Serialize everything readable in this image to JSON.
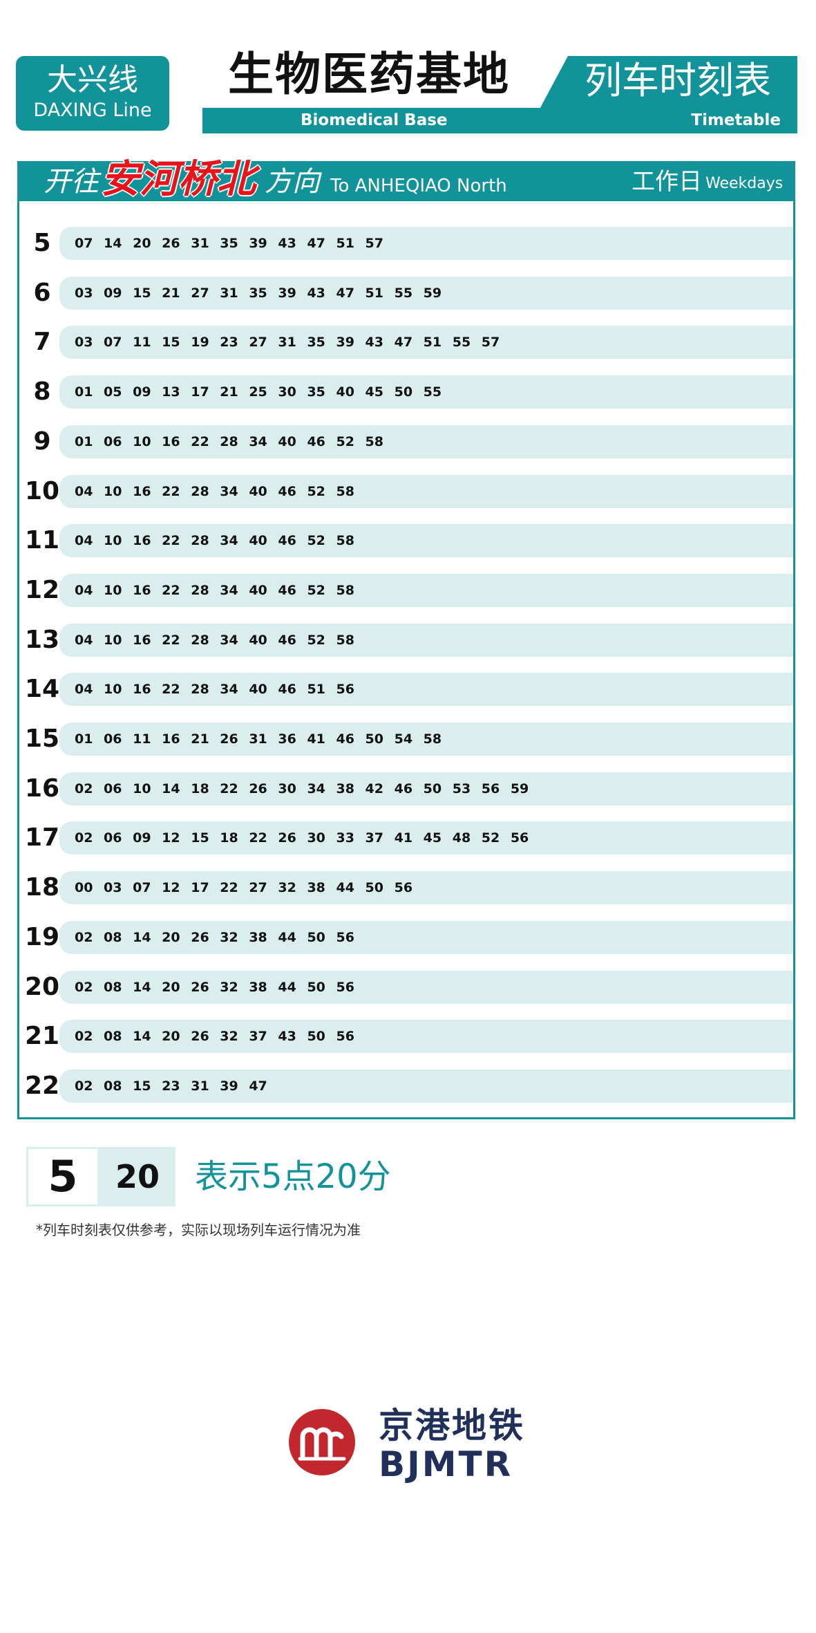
{
  "header": {
    "line_cn": "大兴线",
    "line_en": "DAXING Line",
    "station_cn": "生物医药基地",
    "station_en": "Biomedical Base",
    "timetable_cn": "列车时刻表",
    "timetable_en": "Timetable"
  },
  "panel": {
    "direction_prefix": "开往",
    "direction_name": "安河桥北",
    "direction_suffix": "方向",
    "direction_en": "To ANHEQIAO North",
    "day_cn": "工作日",
    "day_en": "Weekdays"
  },
  "schedule": [
    {
      "hour": "5",
      "minutes": "07 14 20 26 31 35 39 43 47 51 57"
    },
    {
      "hour": "6",
      "minutes": "03 09 15 21 27 31 35 39 43 47 51 55 59"
    },
    {
      "hour": "7",
      "minutes": "03 07 11 15 19 23 27 31 35 39 43 47 51 55 57"
    },
    {
      "hour": "8",
      "minutes": "01 05 09 13 17 21 25 30 35 40 45 50 55"
    },
    {
      "hour": "9",
      "minutes": "01 06 10 16 22 28 34 40 46 52 58"
    },
    {
      "hour": "10",
      "minutes": "04 10 16 22 28 34 40 46 52 58"
    },
    {
      "hour": "11",
      "minutes": "04 10 16 22 28 34 40 46 52 58"
    },
    {
      "hour": "12",
      "minutes": "04 10 16 22 28 34 40 46 52 58"
    },
    {
      "hour": "13",
      "minutes": "04 10 16 22 28 34 40 46 52 58"
    },
    {
      "hour": "14",
      "minutes": "04 10 16 22 28 34 40 46 51 56"
    },
    {
      "hour": "15",
      "minutes": "01 06 11 16 21 26 31 36 41 46 50 54 58"
    },
    {
      "hour": "16",
      "minutes": "02 06 10 14 18 22 26 30 34 38 42 46 50 53 56 59"
    },
    {
      "hour": "17",
      "minutes": "02 06 09 12 15 18 22 26 30 33 37 41 45 48 52 56"
    },
    {
      "hour": "18",
      "minutes": "00 03 07 12 17 22 27 32 38 44 50 56"
    },
    {
      "hour": "19",
      "minutes": "02 08 14 20 26 32 38 44 50 56"
    },
    {
      "hour": "20",
      "minutes": "02 08 14 20 26 32 38 44 50 56"
    },
    {
      "hour": "21",
      "minutes": "02 08 14 20 26 32 37 43 50 56"
    },
    {
      "hour": "22",
      "minutes": "02 08 15 23 31 39 47"
    }
  ],
  "legend": {
    "hour": "5",
    "minute": "20",
    "text": "表示5点20分"
  },
  "note": "*列车时刻表仅供参考，实际以现场列车运行情况为准",
  "logo": {
    "cn": "京港地铁",
    "en": "BJMTR",
    "icon": "bjmtr-logo-icon"
  },
  "colors": {
    "brand_teal": "#12939a",
    "stripe": "#daeeee",
    "direction_red": "#e8141c",
    "logo_red": "#c1272d",
    "logo_navy": "#20305a"
  }
}
